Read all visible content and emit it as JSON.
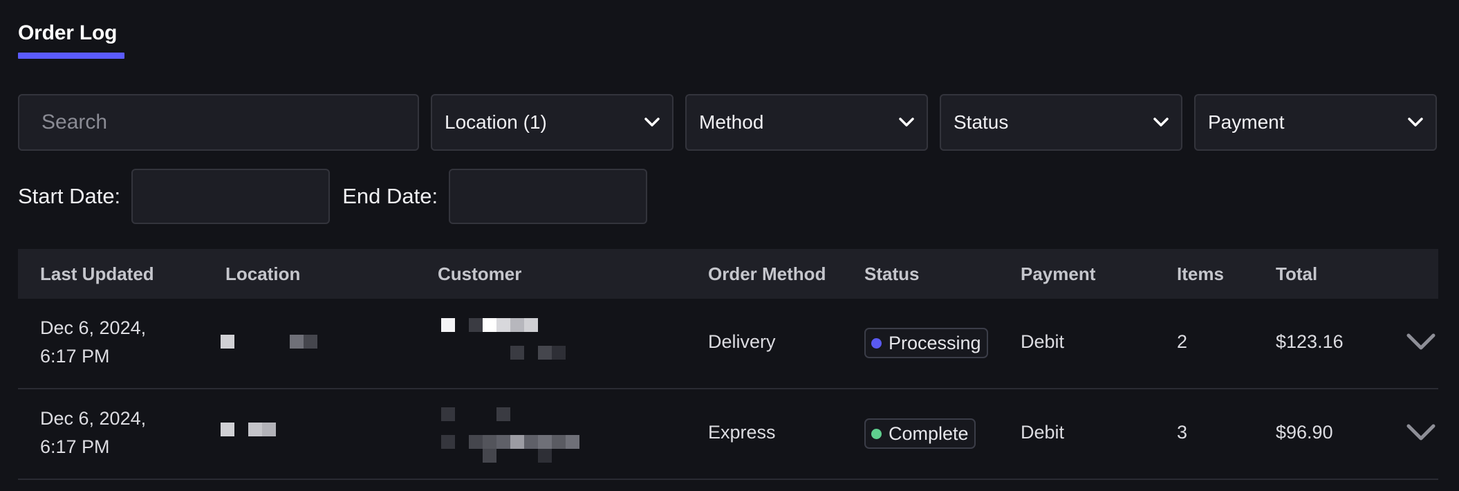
{
  "header": {
    "title": "Order Log"
  },
  "filters": {
    "search_placeholder": "Search",
    "location_label": "Location (1)",
    "method_label": "Method",
    "status_label": "Status",
    "payment_label": "Payment"
  },
  "dates": {
    "start_label": "Start Date:",
    "end_label": "End Date:"
  },
  "table": {
    "columns": [
      "Last Updated",
      "Location",
      "Customer",
      "Order Method",
      "Status",
      "Payment",
      "Items",
      "Total"
    ],
    "rows": [
      {
        "date_line1": "Dec 6, 2024,",
        "date_line2": "6:17 PM",
        "method": "Delivery",
        "status": "Processing",
        "status_color": "#5a5af0",
        "payment": "Debit",
        "items": "2",
        "total": "$123.16"
      },
      {
        "date_line1": "Dec 6, 2024,",
        "date_line2": "6:17 PM",
        "method": "Express",
        "status": "Complete",
        "status_color": "#5fcf8e",
        "payment": "Debit",
        "items": "3",
        "total": "$96.90"
      }
    ]
  },
  "colors": {
    "accent": "#5b5bff",
    "background": "#121318"
  },
  "icons": {
    "dropdown": "chevron-down-icon",
    "expand": "chevron-down-icon"
  }
}
